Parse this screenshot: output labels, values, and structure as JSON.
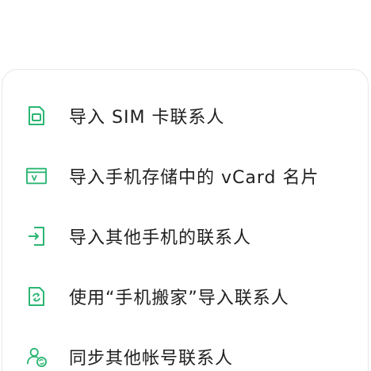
{
  "accent_color": "#2bb673",
  "menu": {
    "items": [
      {
        "label": "导入 SIM 卡联系人",
        "icon": "sim-card-icon"
      },
      {
        "label": "导入手机存储中的 vCard 名片",
        "icon": "vcard-icon"
      },
      {
        "label": "导入其他手机的联系人",
        "icon": "import-icon"
      },
      {
        "label": "使用“手机搬家”导入联系人",
        "icon": "phone-clone-icon"
      },
      {
        "label": "同步其他帐号联系人",
        "icon": "account-sync-icon"
      }
    ]
  }
}
